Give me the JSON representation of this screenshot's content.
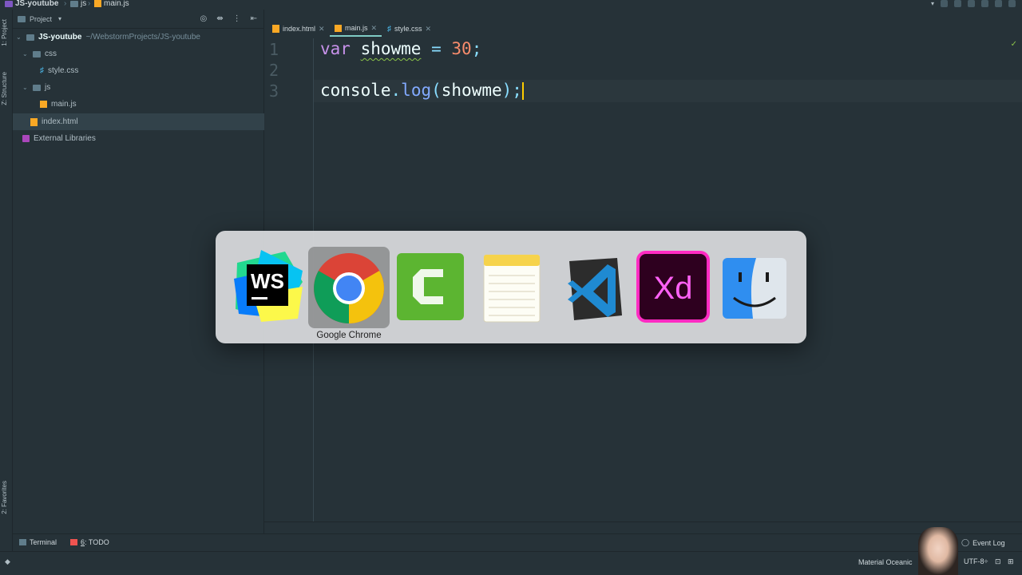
{
  "window": {
    "breadcrumb": [
      "JS-youtube",
      "js",
      "main.js"
    ]
  },
  "left_strip": {
    "tabs": [
      "1: Project",
      "Z: Structure",
      "2: Favorites"
    ]
  },
  "project_panel": {
    "header_label": "Project",
    "tree": [
      {
        "label": "JS-youtube",
        "path": "~/WebstormProjects/JS-youtube",
        "type": "folder-root"
      },
      {
        "label": "css",
        "type": "folder"
      },
      {
        "label": "style.css",
        "type": "css-file"
      },
      {
        "label": "js",
        "type": "folder"
      },
      {
        "label": "main.js",
        "type": "js-file"
      },
      {
        "label": "index.html",
        "type": "html-file",
        "selected": true
      },
      {
        "label": "External Libraries",
        "type": "library"
      }
    ]
  },
  "editor": {
    "tabs": [
      {
        "label": "index.html",
        "icon": "html-file-icon"
      },
      {
        "label": "main.js",
        "icon": "js-file-icon",
        "active": true
      },
      {
        "label": "style.css",
        "icon": "css-file-icon"
      }
    ],
    "line_numbers": [
      "1",
      "2",
      "3"
    ],
    "code": {
      "line1": {
        "kw": "var",
        "name": "showme",
        "op": " = ",
        "num": "30",
        "semi": ";"
      },
      "line3": {
        "obj": "console",
        "dot": ".",
        "fn": "log",
        "open": "(",
        "arg": "showme",
        "close": ")",
        "semi": ";"
      }
    }
  },
  "tool_windows": {
    "terminal": "Terminal",
    "todo_num": "6",
    "todo_label": ": TODO",
    "event_log": "Event Log"
  },
  "status_bar": {
    "theme": "Material Oceanic",
    "encoding": "UTF-8÷"
  },
  "app_switcher": {
    "apps": [
      {
        "name": "WebStorm",
        "icon": "webstorm-icon"
      },
      {
        "name": "Google Chrome",
        "icon": "chrome-icon",
        "selected": true
      },
      {
        "name": "Camtasia",
        "icon": "camtasia-icon"
      },
      {
        "name": "Notes",
        "icon": "notes-icon"
      },
      {
        "name": "Visual Studio Code",
        "icon": "vscode-icon"
      },
      {
        "name": "Adobe XD",
        "icon": "adobe-xd-icon"
      },
      {
        "name": "Finder",
        "icon": "finder-icon"
      }
    ],
    "selected_label": "Google Chrome",
    "ws_text": "WS",
    "xd_text": "Xd"
  },
  "colors": {
    "background": "#263238",
    "keyword": "#c792ea",
    "number": "#f78c6c",
    "function": "#82aaff",
    "accent": "#80cbc4",
    "switcher_bg": "#d6d8da"
  }
}
